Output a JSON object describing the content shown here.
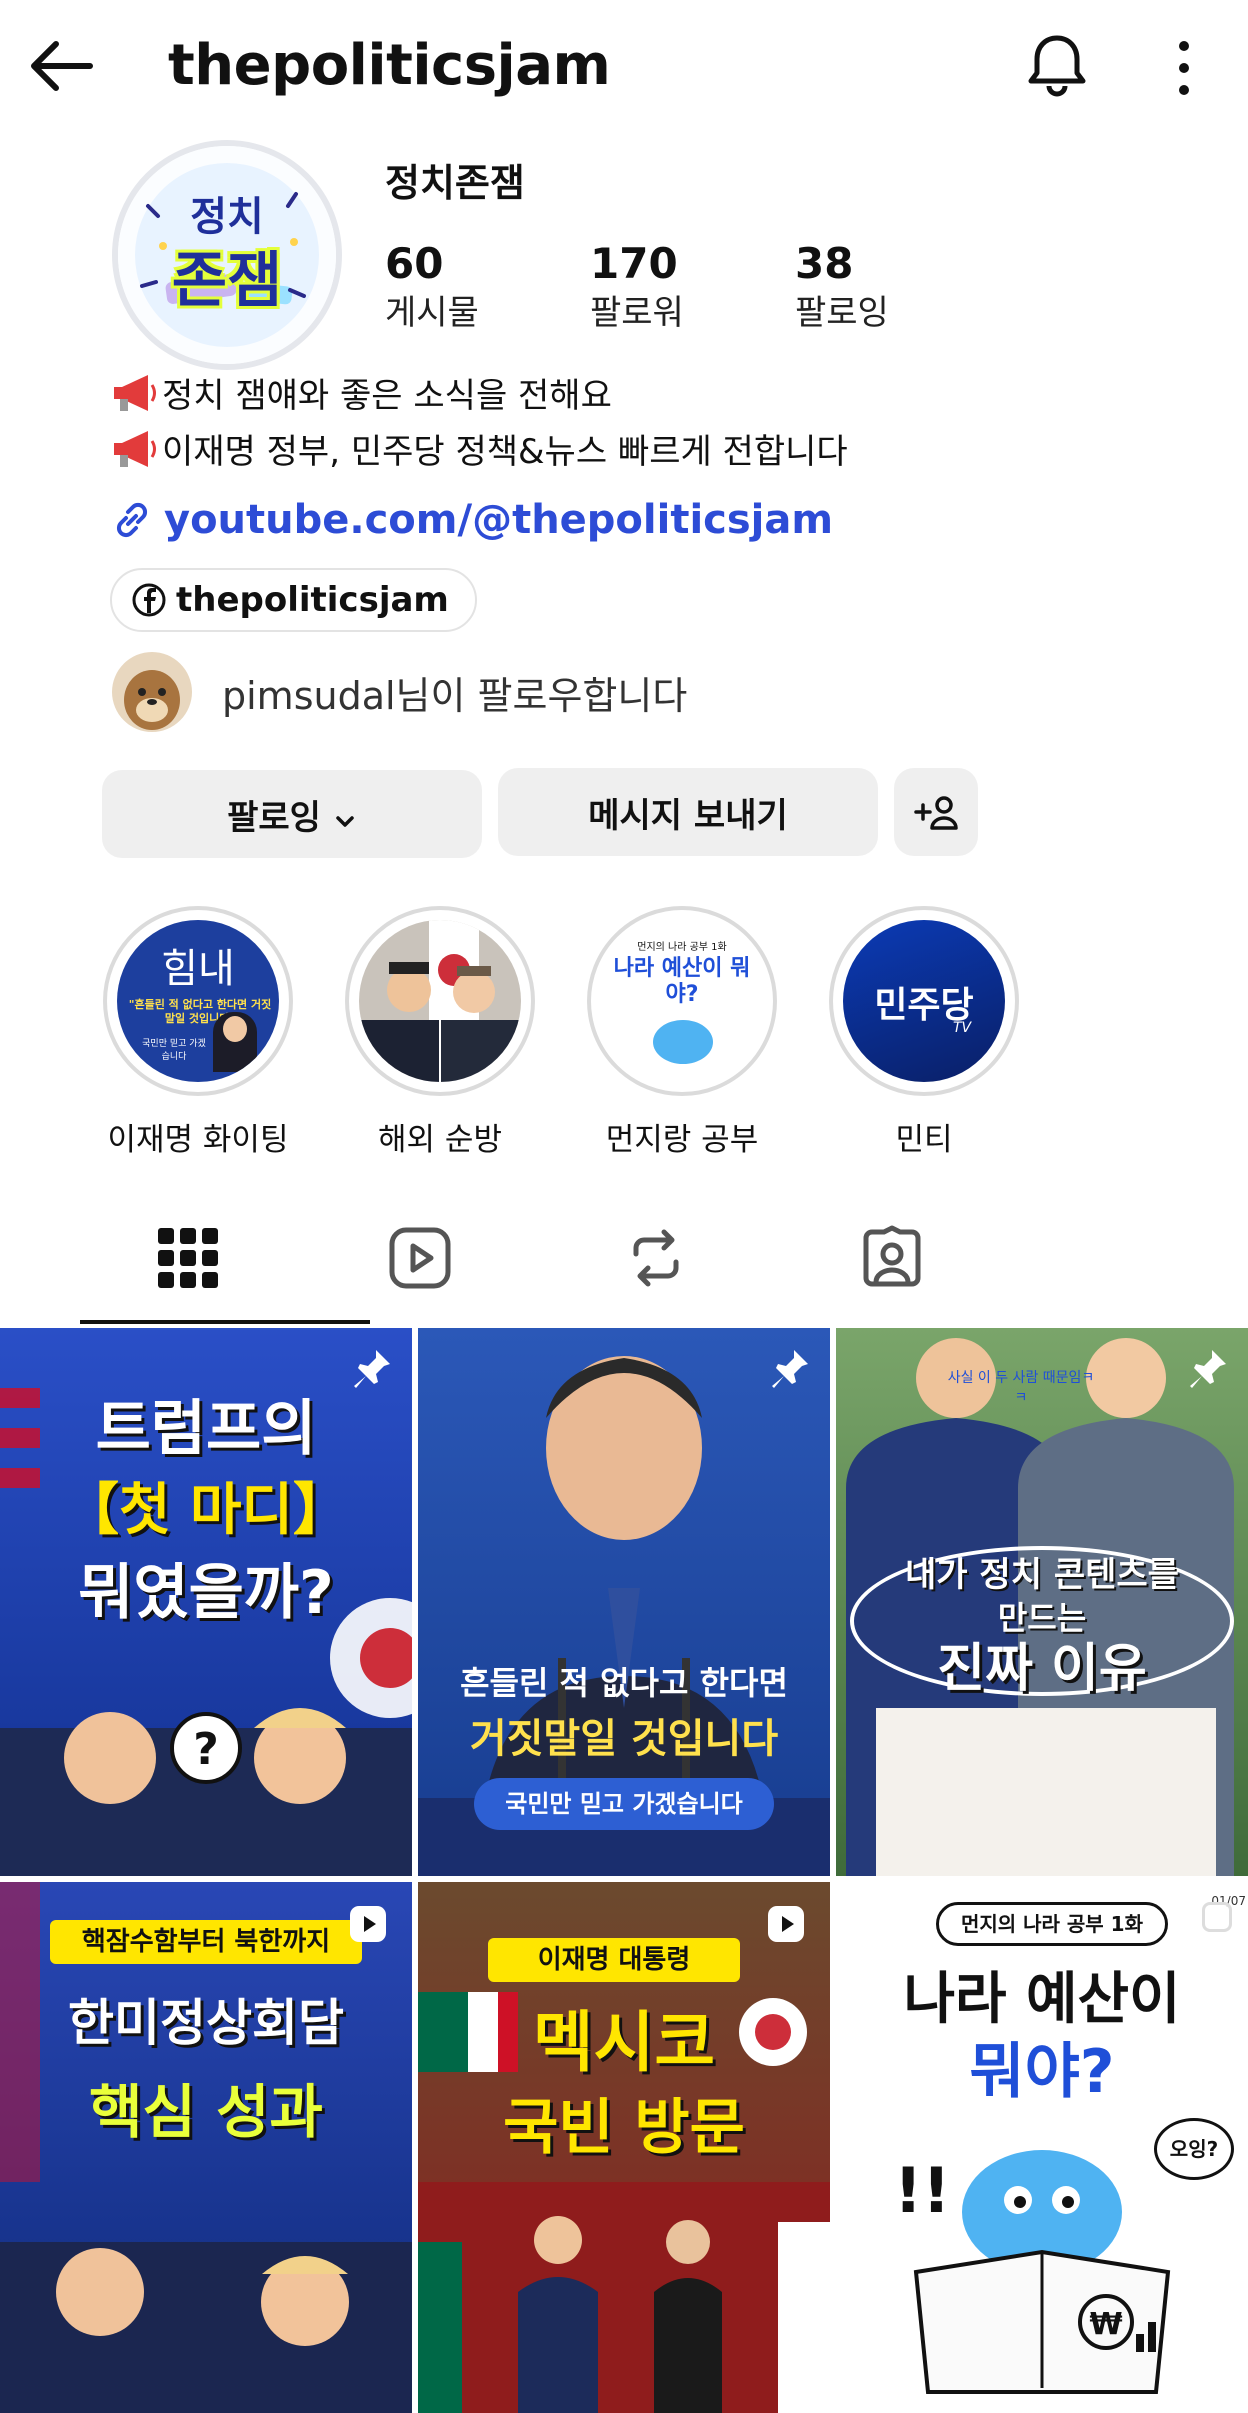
{
  "header": {
    "title": "thepoliticsjam",
    "back_icon": "arrow-left-icon",
    "bell_icon": "bell-icon",
    "more_icon": "more-vertical-icon"
  },
  "profile": {
    "name": "정치존잼",
    "avatar_text_top": "정치",
    "avatar_text_bottom": "존잼",
    "stats": [
      {
        "value": "60",
        "label": "게시물"
      },
      {
        "value": "170",
        "label": "팔로워"
      },
      {
        "value": "38",
        "label": "팔로잉"
      }
    ],
    "bio_lines": [
      "정치 잼얘와 좋은 소식을 전해요",
      "이재명 정부, 민주당 정책&뉴스 빠르게 전합니다"
    ],
    "link": "youtube.com/@thepoliticsjam",
    "facebook_chip": "thepoliticsjam",
    "followed_by_user": "pimsudal",
    "followed_by_suffix": "님이 팔로우합니다"
  },
  "buttons": {
    "following": "팔로잉",
    "message": "메시지 보내기"
  },
  "highlights": [
    {
      "label": "이재명 화이팅",
      "thumb_text": "힘내",
      "thumb_caption": "\"흔들린 적 없다고 한다면 거짓말일 것입니다\"",
      "thumb_sub": "국민만 믿고 가겠습니다"
    },
    {
      "label": "해외 순방"
    },
    {
      "label": "먼지랑 공부",
      "thumb_text": "나라 예산이 뭐야?",
      "thumb_top": "먼지의 나라 공부 1화"
    },
    {
      "label": "민티",
      "thumb_text": "민주당",
      "thumb_sub": "TV"
    }
  ],
  "tabs": [
    "grid-icon",
    "reels-icon",
    "reposts-icon",
    "tagged-icon"
  ],
  "posts": [
    {
      "lines": [
        "트럼프의",
        "【첫 마디】",
        "뭐였을까?"
      ],
      "badge": "pin"
    },
    {
      "lines": [
        "흔들린 적 없다고 한다면",
        "거짓말일 것입니다"
      ],
      "sub": "국민만 믿고 가겠습니다",
      "badge": "pin"
    },
    {
      "lines": [
        "내가 정치 콘텐츠를",
        "만드는",
        "진짜 이유"
      ],
      "note": "사실 이 두 사람 때문임ㅋㅋ",
      "badge": "pin"
    },
    {
      "lines": [
        "핵잠수함부터 북한까지",
        "한미정상회담",
        "핵심 성과"
      ],
      "badge": "reel"
    },
    {
      "lines": [
        "이재명 대통령",
        "멕시코",
        "국빈 방문"
      ],
      "badge": "reel"
    },
    {
      "lines": [
        "먼지의 나라 공부 1화",
        "나라 예산이",
        "뭐야?"
      ],
      "bubble": "오잉?",
      "date": "01/07",
      "badge": "select"
    }
  ]
}
